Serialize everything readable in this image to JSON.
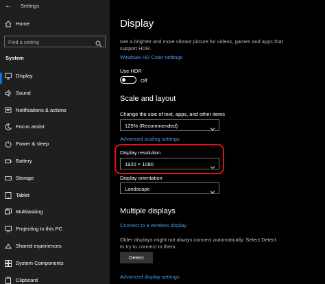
{
  "window": {
    "title": "Settings"
  },
  "sidebar": {
    "home_label": "Home",
    "search_placeholder": "Find a setting",
    "section": "System",
    "items": [
      {
        "label": "Display",
        "icon": "monitor-icon"
      },
      {
        "label": "Sound",
        "icon": "speaker-icon"
      },
      {
        "label": "Notifications & actions",
        "icon": "notification-icon"
      },
      {
        "label": "Focus assist",
        "icon": "moon-icon"
      },
      {
        "label": "Power & sleep",
        "icon": "power-icon"
      },
      {
        "label": "Battery",
        "icon": "battery-icon"
      },
      {
        "label": "Storage",
        "icon": "storage-icon"
      },
      {
        "label": "Tablet",
        "icon": "tablet-icon"
      },
      {
        "label": "Multitasking",
        "icon": "multitasking-icon"
      },
      {
        "label": "Projecting to this PC",
        "icon": "projecting-icon"
      },
      {
        "label": "Shared experiences",
        "icon": "shared-icon"
      },
      {
        "label": "System Components",
        "icon": "components-icon"
      },
      {
        "label": "Clipboard",
        "icon": "clipboard-icon"
      }
    ]
  },
  "main": {
    "title": "Display",
    "hdr_description": "Get a brighter and more vibrant picture for videos, games and apps that support HDR.",
    "hdr_link": "Windows HD Color settings",
    "use_hdr_label": "Use HDR",
    "use_hdr_state": "Off",
    "scale_heading": "Scale and layout",
    "scale_label": "Change the size of text, apps, and other items",
    "scale_value": "125% (Recommended)",
    "advanced_scaling_link": "Advanced scaling settings",
    "resolution_label": "Display resolution",
    "resolution_value": "1920 × 1080",
    "orientation_label": "Display orientation",
    "orientation_value": "Landscape",
    "multiple_heading": "Multiple displays",
    "wireless_link": "Connect to a wireless display",
    "detect_description": "Older displays might not always connect automatically. Select Detect to try to connect to them.",
    "detect_button": "Detect",
    "advanced_display_link": "Advanced display settings"
  },
  "colors": {
    "accent": "#0a74da",
    "link": "#4a9de8",
    "highlight": "#e0111b",
    "sidebar_bg": "#1f1f1f"
  }
}
